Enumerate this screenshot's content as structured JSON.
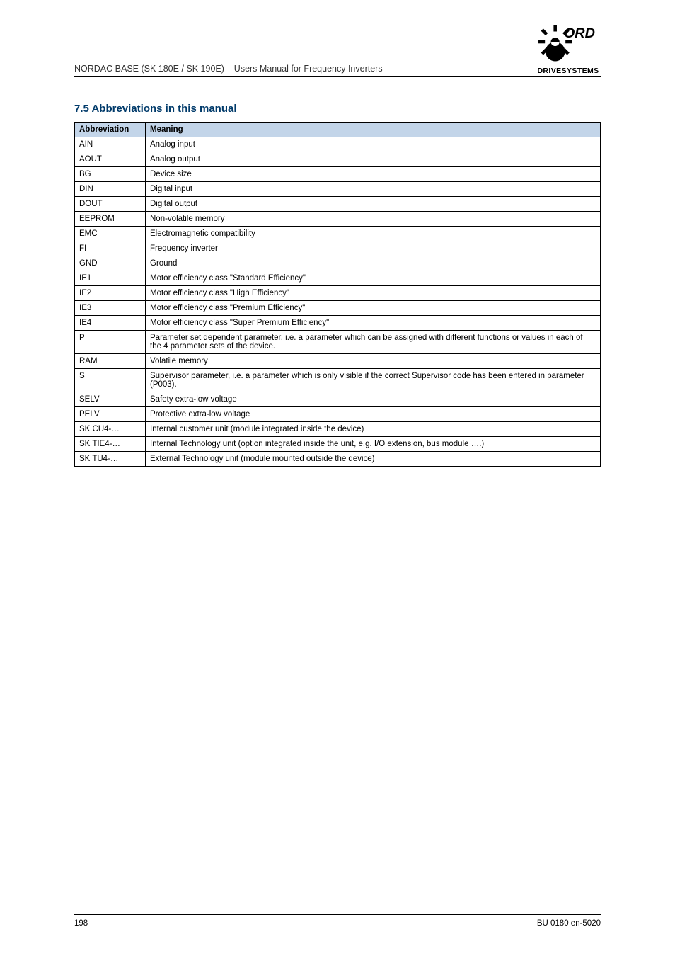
{
  "header": {
    "doc_title": "NORDAC BASE (SK 180E / SK 190E) – Users Manual for Frequency Inverters"
  },
  "section_title": "7.5 Abbreviations in this manual",
  "table": {
    "header": [
      "Abbreviation",
      "Meaning"
    ],
    "rows": [
      [
        "AIN",
        "Analog input"
      ],
      [
        "AOUT",
        "Analog output"
      ],
      [
        "BG",
        "Device size"
      ],
      [
        "DIN",
        "Digital input"
      ],
      [
        "DOUT",
        "Digital output"
      ],
      [
        "EEPROM",
        "Non-volatile memory"
      ],
      [
        "EMC",
        "Electromagnetic compatibility"
      ],
      [
        "FI",
        "Frequency inverter"
      ],
      [
        "GND",
        "Ground"
      ],
      [
        "IE1",
        "Motor efficiency class \"Standard Efficiency\""
      ],
      [
        "IE2",
        "Motor efficiency class \"High Efficiency\""
      ],
      [
        "IE3",
        "Motor efficiency class \"Premium Efficiency\""
      ],
      [
        "IE4",
        "Motor efficiency class \"Super Premium Efficiency\""
      ],
      [
        "P",
        "Parameter set dependent parameter, i.e. a parameter which can be assigned with different functions or values in each of the 4 parameter sets of the device."
      ],
      [
        "RAM",
        "Volatile memory"
      ],
      [
        "S",
        "Supervisor parameter, i.e. a parameter which is only visible if the correct Supervisor code has been entered in parameter (P003)."
      ],
      [
        "SELV",
        "Safety extra-low voltage"
      ],
      [
        "PELV",
        "Protective extra-low voltage"
      ],
      [
        "SK CU4-…",
        "Internal customer unit (module integrated inside the device)"
      ],
      [
        "SK TIE4-…",
        "Internal Technology unit (option integrated inside the unit, e.g. I/O extension, bus module ….)"
      ],
      [
        "SK TU4-…",
        "External Technology unit (module mounted outside the device)"
      ]
    ]
  },
  "footer": {
    "left": "198",
    "right": "BU 0180 en-5020"
  }
}
